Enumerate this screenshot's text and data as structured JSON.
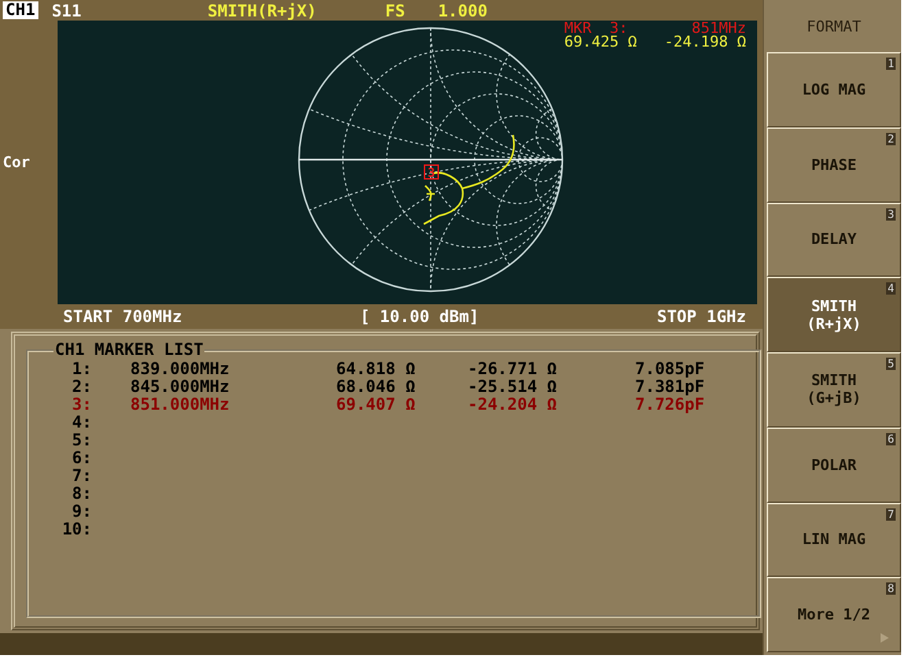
{
  "header": {
    "channel": "CH1",
    "parameter": "S11",
    "format": "SMITH(R+jX)",
    "scale_label": "FS",
    "scale_value": "1.000"
  },
  "side_label": "Cor",
  "marker_readout": {
    "label": "MKR  3:",
    "frequency": "851MHz",
    "real": "69.425 Ω",
    "imag": "-24.198 Ω"
  },
  "chart_marker": "3",
  "footer": {
    "start": "START 700MHz",
    "power": "[ 10.00 dBm]",
    "stop": "STOP 1GHz"
  },
  "marker_list": {
    "title": "CH1 MARKER LIST",
    "rows": [
      {
        "index": "1:",
        "frequency": "839.000MHz",
        "resistance": "64.818 Ω",
        "reactance": "-26.771 Ω",
        "capacitance": "7.085pF",
        "selected": false
      },
      {
        "index": "2:",
        "frequency": "845.000MHz",
        "resistance": "68.046 Ω",
        "reactance": "-25.514 Ω",
        "capacitance": "7.381pF",
        "selected": false
      },
      {
        "index": "3:",
        "frequency": "851.000MHz",
        "resistance": "69.407 Ω",
        "reactance": "-24.204 Ω",
        "capacitance": "7.726pF",
        "selected": true
      },
      {
        "index": "4:",
        "selected": false
      },
      {
        "index": "5:",
        "selected": false
      },
      {
        "index": "6:",
        "selected": false
      },
      {
        "index": "7:",
        "selected": false
      },
      {
        "index": "8:",
        "selected": false
      },
      {
        "index": "9:",
        "selected": false
      },
      {
        "index": "10:",
        "selected": false
      }
    ]
  },
  "softkeys": {
    "title": "FORMAT",
    "keys": [
      {
        "lines": [
          "LOG MAG"
        ],
        "number": "1",
        "selected": false
      },
      {
        "lines": [
          "PHASE"
        ],
        "number": "2",
        "selected": false
      },
      {
        "lines": [
          "DELAY"
        ],
        "number": "3",
        "selected": false
      },
      {
        "lines": [
          "SMITH",
          "(R+jX)"
        ],
        "number": "4",
        "selected": true
      },
      {
        "lines": [
          "SMITH",
          "(G+jB)"
        ],
        "number": "5",
        "selected": false
      },
      {
        "lines": [
          "POLAR"
        ],
        "number": "6",
        "selected": false
      },
      {
        "lines": [
          "LIN MAG"
        ],
        "number": "7",
        "selected": false
      },
      {
        "lines": [
          "More 1/2"
        ],
        "number": "8",
        "selected": false,
        "kind": "more"
      }
    ]
  }
}
